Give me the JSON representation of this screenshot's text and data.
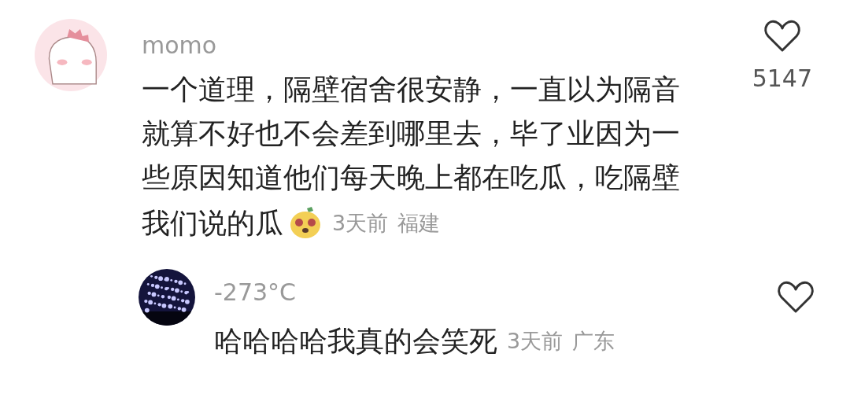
{
  "comments": [
    {
      "username": "momo",
      "lines": [
        "一个道理，隔壁宿舍很安静，一直以为隔音",
        "就算不好也不会差到哪里去，毕了业因为一",
        "些原因知道他们每天晚上都在吃瓜，吃隔壁",
        "我们说的瓜"
      ],
      "has_emoji": true,
      "time": "3天前",
      "location": "福建",
      "likes": "5147",
      "liked": false,
      "replies": [
        {
          "username": "-273°C",
          "lines": [
            "哈哈哈哈我真的会笑死"
          ],
          "has_emoji": false,
          "time": "3天前",
          "location": "广东",
          "liked": false
        }
      ]
    }
  ]
}
